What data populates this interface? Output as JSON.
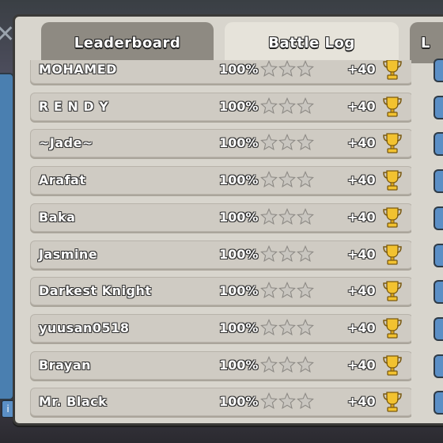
{
  "tabs": {
    "leaderboard": "Leaderboard",
    "battle_log": "Battle Log",
    "third": "L"
  },
  "colors": {
    "panel": "#d8d5cd",
    "row": "#cfcbc3",
    "active_tab": "#e6e3da",
    "inactive_tab": "#8e8a82",
    "trophy": "#f2c230"
  },
  "icons": {
    "close": "close-icon",
    "star": "star-icon",
    "trophy": "trophy-icon"
  },
  "rows": [
    {
      "name": "MOHAMED",
      "percent": "100%",
      "stars": 0,
      "delta": "+40"
    },
    {
      "name": "R E N D Y",
      "percent": "100%",
      "stars": 0,
      "delta": "+40"
    },
    {
      "name": "~Jade~",
      "percent": "100%",
      "stars": 0,
      "delta": "+40"
    },
    {
      "name": "Arafat",
      "percent": "100%",
      "stars": 0,
      "delta": "+40"
    },
    {
      "name": "Baka",
      "percent": "100%",
      "stars": 0,
      "delta": "+40"
    },
    {
      "name": "Jasmine",
      "percent": "100%",
      "stars": 0,
      "delta": "+40"
    },
    {
      "name": "Darkest Knight",
      "percent": "100%",
      "stars": 0,
      "delta": "+40"
    },
    {
      "name": "yuusan0518",
      "percent": "100%",
      "stars": 0,
      "delta": "+40"
    },
    {
      "name": "Brayan",
      "percent": "100%",
      "stars": 0,
      "delta": "+40"
    },
    {
      "name": "Mr. Black",
      "percent": "100%",
      "stars": 0,
      "delta": "+40"
    }
  ]
}
